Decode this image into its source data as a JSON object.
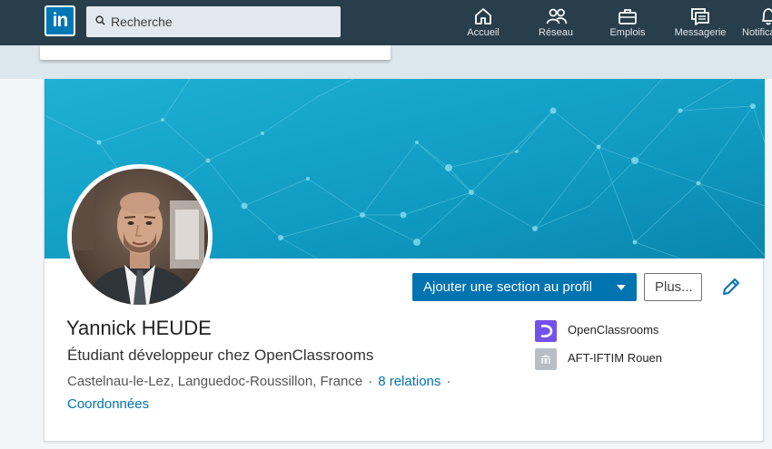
{
  "navbar": {
    "logo_text": "in",
    "search_placeholder": "Recherche",
    "items": [
      {
        "label": "Accueil",
        "icon": "home-icon"
      },
      {
        "label": "Réseau",
        "icon": "network-icon"
      },
      {
        "label": "Emplois",
        "icon": "briefcase-icon"
      },
      {
        "label": "Messagerie",
        "icon": "messaging-icon"
      },
      {
        "label": "Notifications",
        "icon": "bell-icon"
      }
    ]
  },
  "profile": {
    "name": "Yannick HEUDE",
    "headline": "Étudiant développeur chez OpenClassrooms",
    "location": "Castelnau-le-Lez, Languedoc-Roussillon, France",
    "connections": "8 relations",
    "contact_label": "Coordonnées",
    "add_section_label": "Ajouter une section au profil",
    "more_label": "Plus...",
    "organizations": [
      {
        "name": "OpenClassrooms",
        "color": "#7451eb"
      },
      {
        "name": "AFT-IFTIM Rouen",
        "color": "#b8bec3"
      }
    ]
  },
  "colors": {
    "brand": "#0077b5",
    "nav_bg": "#283e4a",
    "button": "#0073b1",
    "banner_start": "#1aa5c9",
    "banner_end": "#0e8fb8"
  }
}
